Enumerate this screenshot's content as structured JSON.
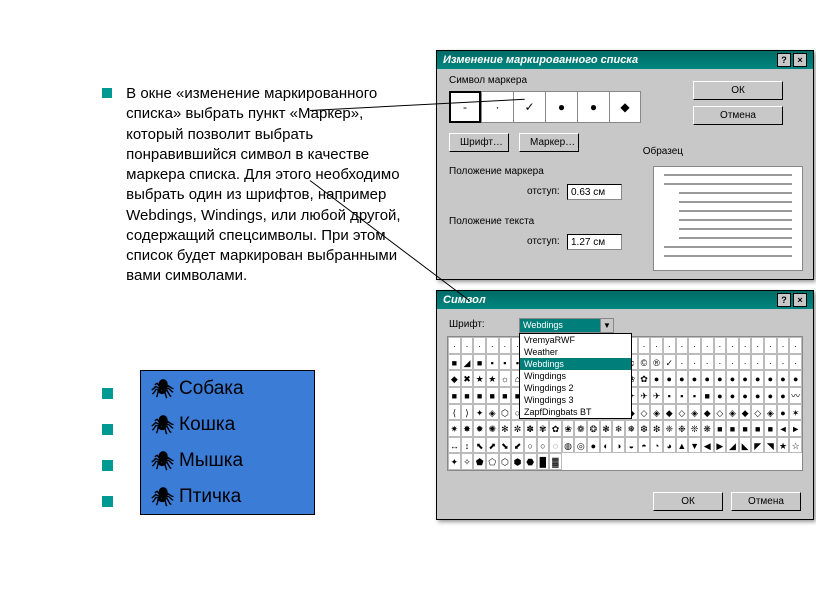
{
  "body_text": "В окне «изменение маркированного списка» выбрать пункт «Маркер», который позволит выбрать понравившийся символ в качестве маркера списка. Для этого необходимо выбрать один из шрифтов, например Webdings, Windings, или любой другой, содержащий спецсимволы. При этом список будет маркирован выбранными вами символами.",
  "examples": [
    "Собака",
    "Кошка",
    "Мышка",
    "Птичка"
  ],
  "dlg1": {
    "title": "Изменение маркированного списка",
    "grp_marker": "Символ маркера",
    "btn_font": "Шрифт…",
    "btn_marker": "Маркер…",
    "btn_ok": "ОК",
    "btn_cancel": "Отмена",
    "grp_sample": "Образец",
    "grp_pos_marker": "Положение маркера",
    "grp_pos_text": "Положение текста",
    "lbl_indent": "отступ:",
    "val_indent1": "0.63 см",
    "val_indent2": "1.27 см",
    "markers": [
      "-",
      "·",
      "✓",
      "●",
      "●",
      "◆"
    ]
  },
  "dlg2": {
    "title": "Символ",
    "lbl_font": "Шрифт:",
    "sel_font": "Webdings",
    "fonts": [
      "VremyaRWF",
      "Weather",
      "Webdings",
      "Wingdings",
      "Wingdings 2",
      "Wingdings 3",
      "ZapfDingbats BT"
    ],
    "btn_ok": "ОК",
    "btn_cancel": "Отмена",
    "cells": [
      "·",
      "·",
      "·",
      "·",
      "·",
      "·",
      "·",
      "·",
      "·",
      "·",
      "·",
      "·",
      "·",
      "·",
      "·",
      "·",
      "·",
      "·",
      "·",
      "·",
      "·",
      "·",
      "·",
      "·",
      "·",
      "·",
      "·",
      "·",
      "■",
      "◢",
      "■",
      "▪",
      "▪",
      "▪",
      "◂",
      "▸",
      "◂◂",
      "▸▸",
      "■",
      "■",
      "||",
      "■",
      "♫",
      "©",
      "®",
      "✓",
      "·",
      "·",
      "·",
      "·",
      "·",
      "·",
      "·",
      "·",
      "·",
      "·",
      "◆",
      "✖",
      "★",
      "★",
      "☼",
      "⌂",
      "⌂",
      "⌂",
      "⌂",
      "✽",
      "✚",
      "❀",
      "✿",
      "✿",
      "❀",
      "✿",
      "●",
      "●",
      "●",
      "●",
      "●",
      "●",
      "●",
      "●",
      "●",
      "●",
      "●",
      "●",
      "■",
      "■",
      "■",
      "■",
      "■",
      "■",
      "■",
      "■",
      "ℬ",
      "ℬ",
      "ℬ",
      "ℬ",
      "✈",
      "✈",
      "✈",
      "✈",
      "✈",
      "▪",
      "▪",
      "▪",
      "■",
      "●",
      "●",
      "●",
      "●",
      "●",
      "●",
      "〰",
      "⟨",
      "⟩",
      "✦",
      "◈",
      "⬡",
      "○",
      "●",
      "●",
      "╱",
      "╲",
      "╳",
      "◆",
      "◇",
      "◈",
      "◆",
      "◇",
      "◈",
      "◆",
      "◇",
      "◈",
      "◆",
      "◇",
      "◈",
      "◆",
      "◇",
      "◈",
      "●",
      "✶",
      "✷",
      "✸",
      "✹",
      "✺",
      "✻",
      "✼",
      "✽",
      "✾",
      "✿",
      "❀",
      "❁",
      "❂",
      "❃",
      "❄",
      "❅",
      "❆",
      "❇",
      "❈",
      "❉",
      "❊",
      "❋",
      "■",
      "■",
      "■",
      "■",
      "■",
      "◄",
      "►",
      "↔",
      "↕",
      "⬉",
      "⬈",
      "⬊",
      "⬋",
      "○",
      "○",
      "◌",
      "◍",
      "◎",
      "●",
      "◐",
      "◑",
      "◒",
      "◓",
      "◔",
      "◕",
      "▲",
      "▼",
      "◀",
      "▶",
      "◢",
      "◣",
      "◤",
      "◥",
      "★",
      "☆",
      "✦",
      "✧",
      "⬟",
      "⬠",
      "⬡",
      "⬢",
      "⬣",
      "█",
      "▓"
    ]
  }
}
